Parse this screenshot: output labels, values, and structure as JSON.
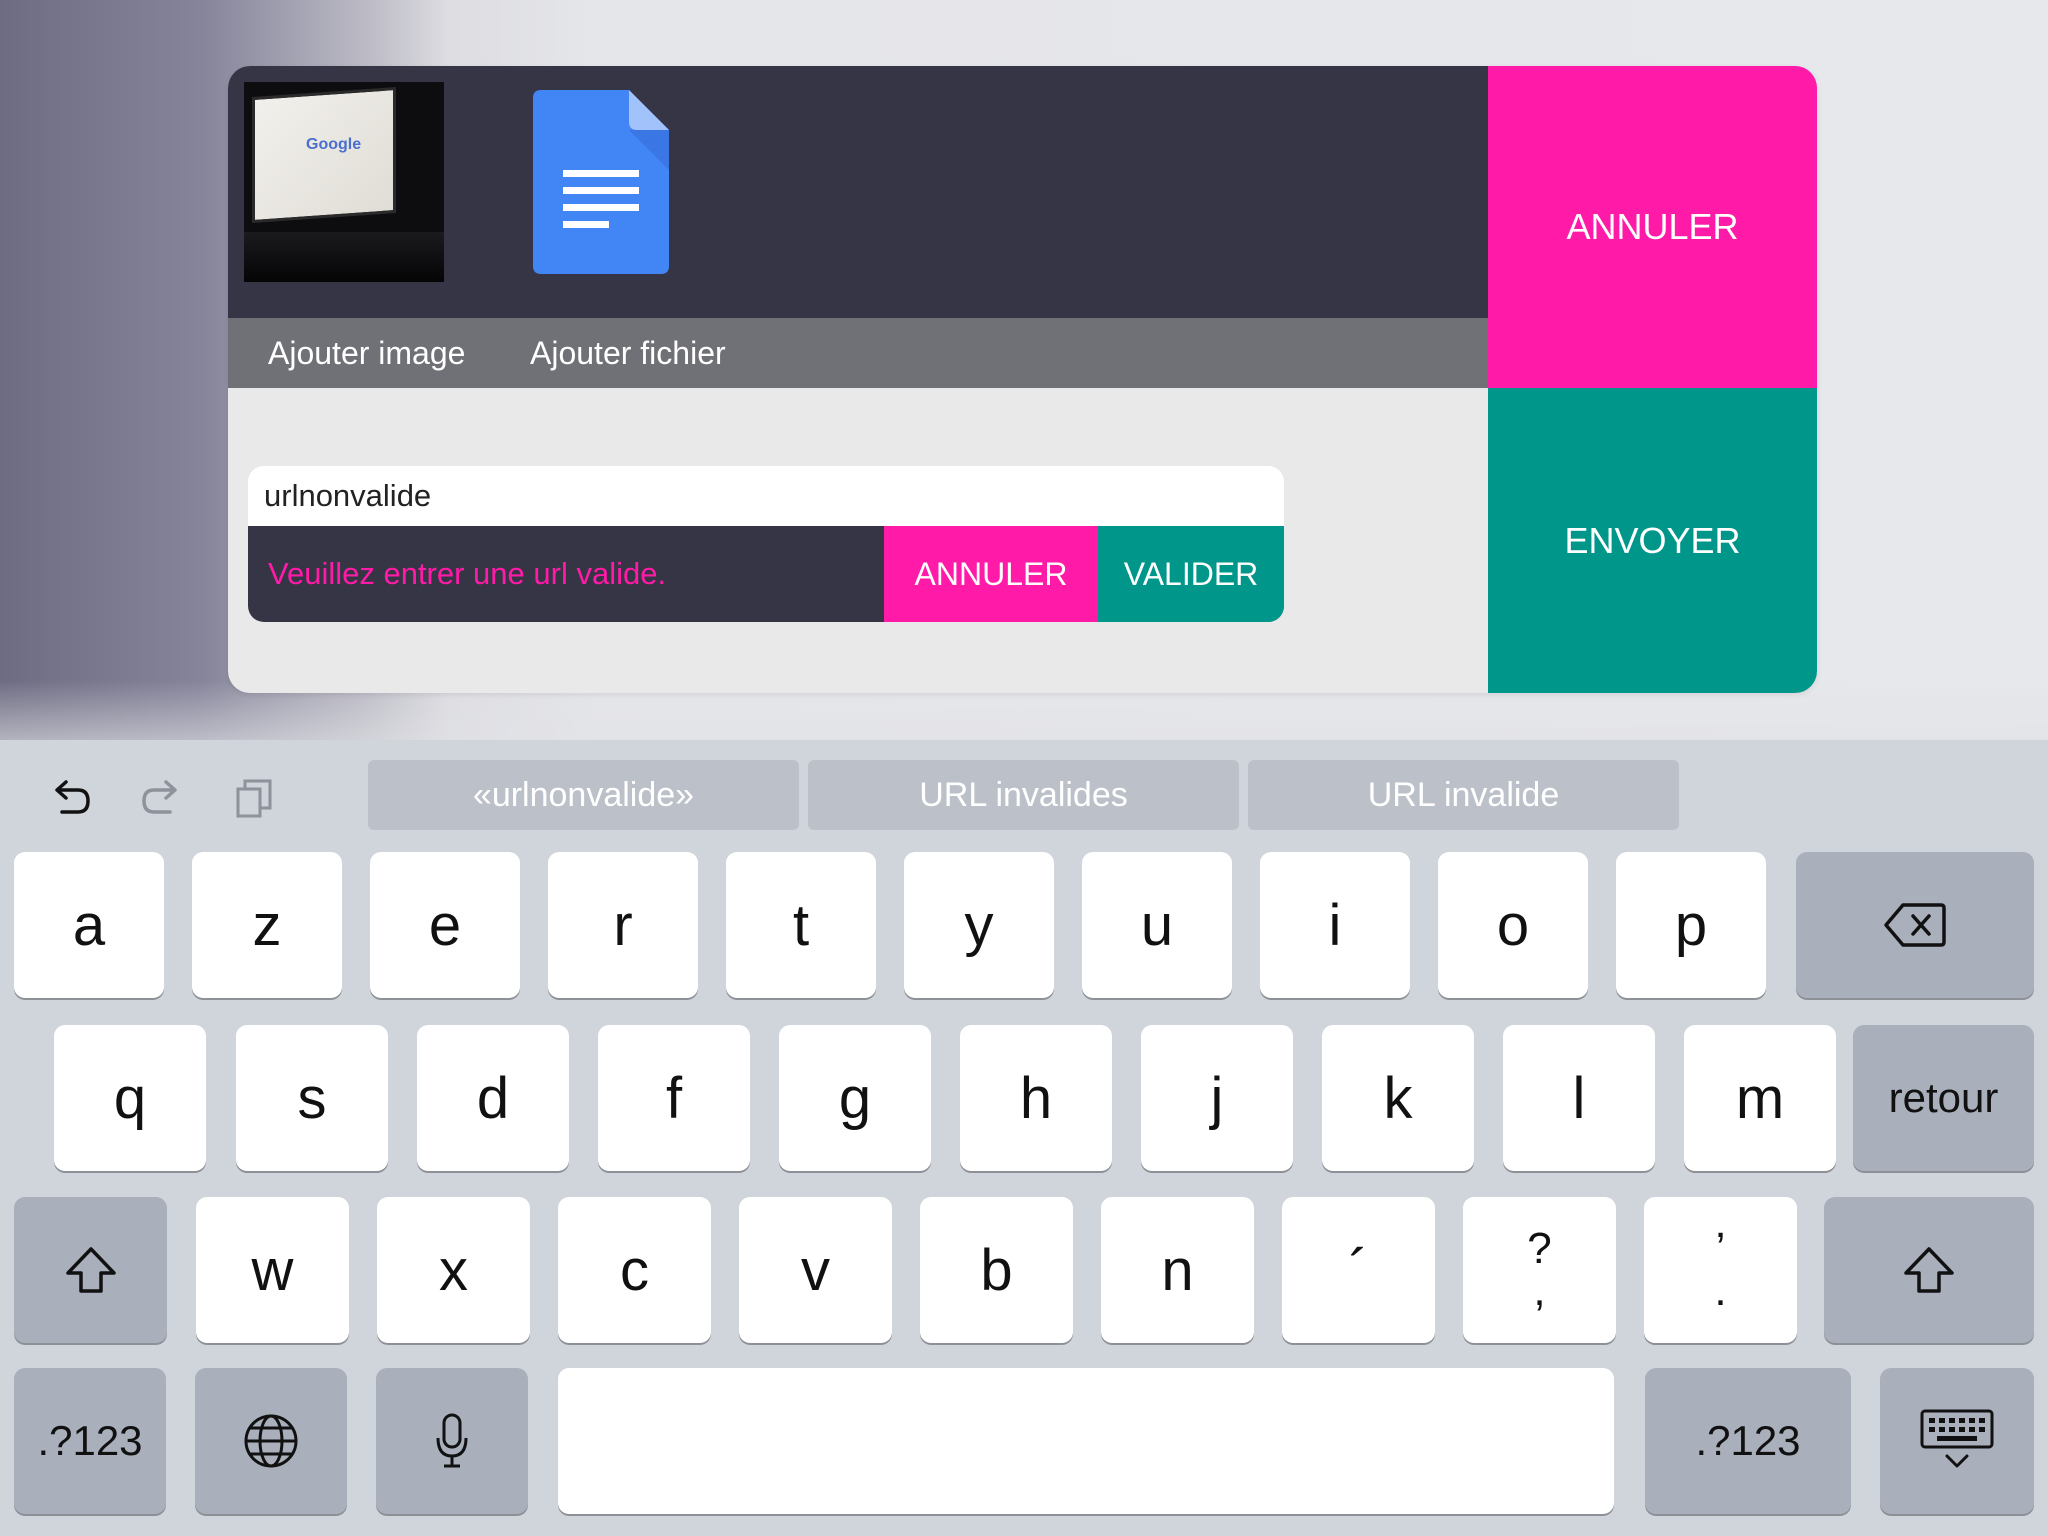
{
  "attachments": {
    "image_label": "Ajouter image",
    "file_label": "Ajouter fichier",
    "thumbnail_logo": "Google"
  },
  "side_buttons": {
    "cancel": "ANNULER",
    "send": "ENVOYER"
  },
  "url_dialog": {
    "value": "urlnonvalide",
    "error": "Veuillez entrer une url valide.",
    "cancel": "ANNULER",
    "validate": "VALIDER"
  },
  "keyboard": {
    "suggestions": [
      "«urlnonvalide»",
      "URL invalides",
      "URL invalide"
    ],
    "row1": [
      "a",
      "z",
      "e",
      "r",
      "t",
      "y",
      "u",
      "i",
      "o",
      "p"
    ],
    "row2": [
      "q",
      "s",
      "d",
      "f",
      "g",
      "h",
      "j",
      "k",
      "l",
      "m"
    ],
    "return_label": "retour",
    "row3": [
      "w",
      "x",
      "c",
      "v",
      "b",
      "n"
    ],
    "accent_key": "´",
    "question_key": {
      "top": "?",
      "bottom": ","
    },
    "apostrophe_key": {
      "top": "’",
      "bottom": "."
    },
    "numbers_label": ".?123"
  },
  "icons": {
    "undo": "undo-icon",
    "redo": "redo-icon",
    "paste": "paste-icon",
    "backspace": "backspace-icon",
    "shift": "shift-icon",
    "globe": "globe-icon",
    "mic": "microphone-icon",
    "hide_keyboard": "keyboard-hide-icon",
    "document": "google-docs-icon"
  },
  "colors": {
    "accent_pink": "#ff1aa8",
    "accent_teal": "#00968a",
    "panel_dark": "#353545"
  }
}
